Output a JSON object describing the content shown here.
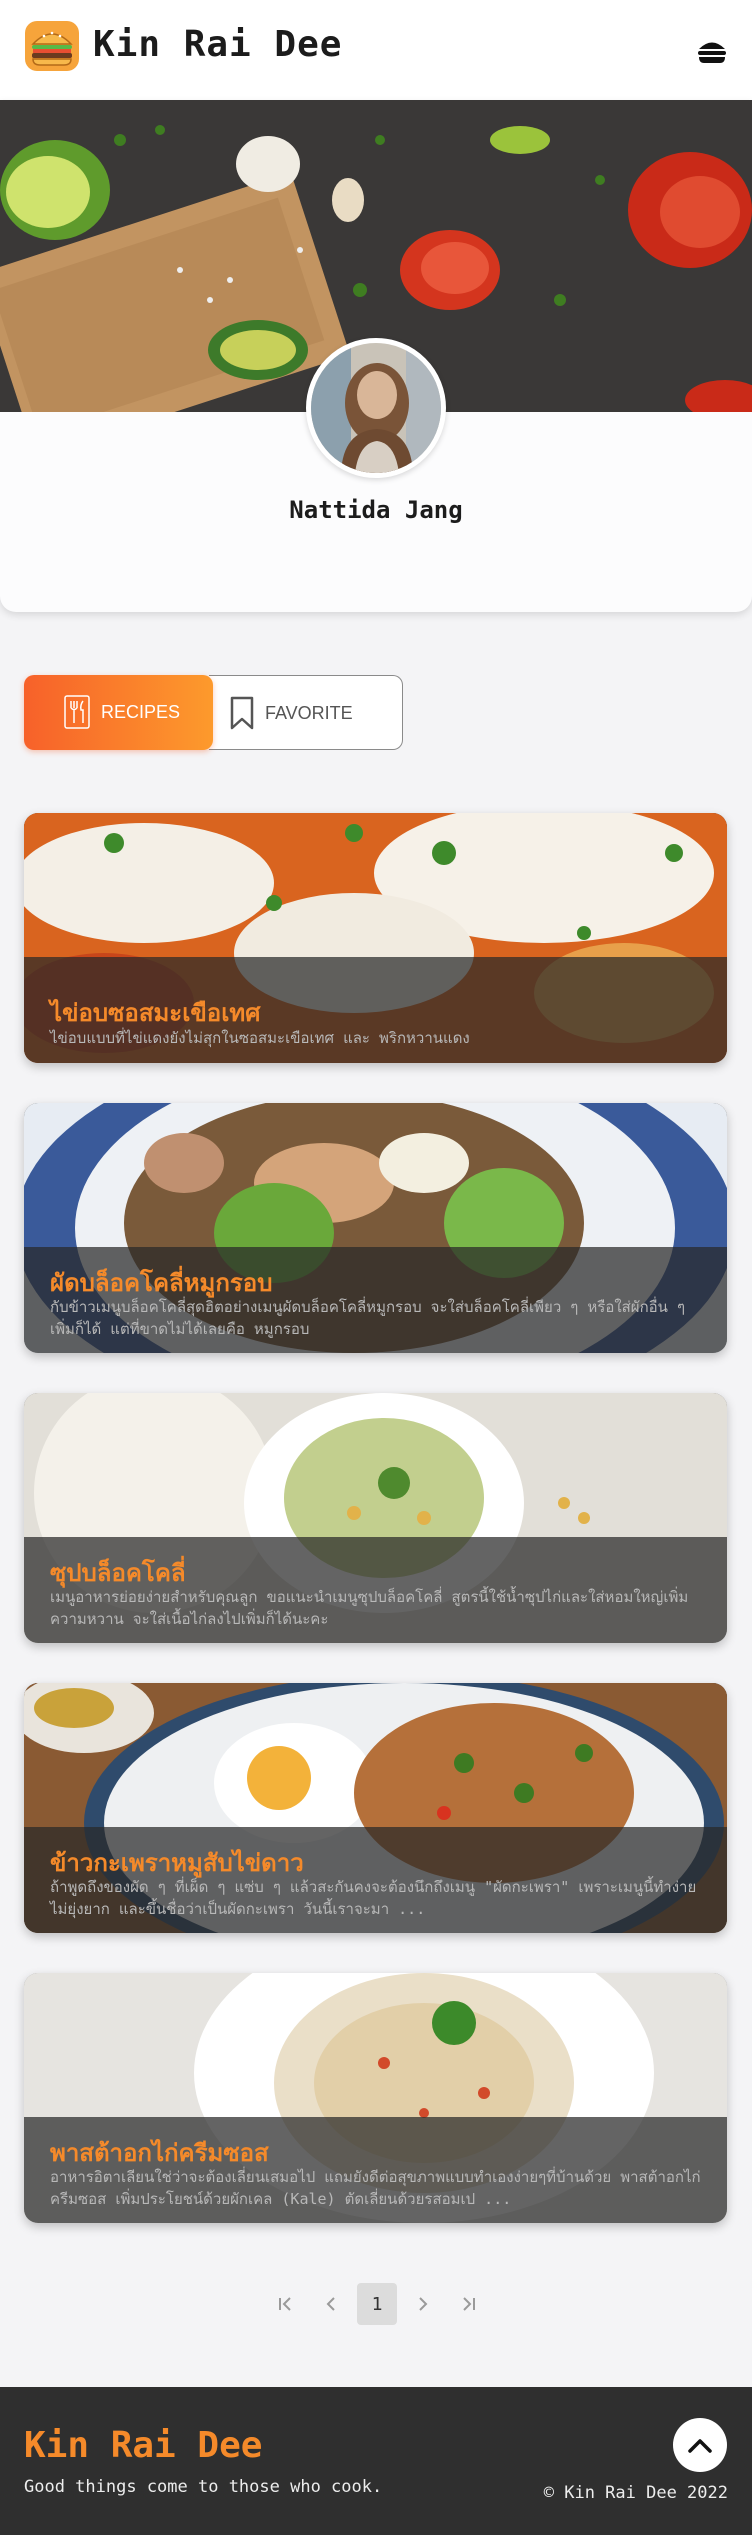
{
  "header": {
    "brand": "Kin Rai Dee",
    "logo_icon": "burger-icon",
    "menu_icon": "burger-menu-icon"
  },
  "profile": {
    "name": "Nattida Jang"
  },
  "tabs": [
    {
      "label": "RECIPES",
      "icon": "cutlery-icon",
      "active": true
    },
    {
      "label": "FAVORITE",
      "icon": "bookmark-icon",
      "active": false
    }
  ],
  "recipes": [
    {
      "title": "ไข่อบซอสมะเขือเทศ",
      "description": "ไข่อบแบบที่ไข่แดงยังไม่สุกในซอสมะเขือเทศ และ พริกหวานแดง"
    },
    {
      "title": "ผัดบล็อคโคลี่หมูกรอบ",
      "description": "กับข้าวเมนูบล็อคโคลี่สุดฮิตอย่างเมนูผัดบล็อคโคลี่หมูกรอบ จะใส่บล็อคโคลี่เพียว ๆ หรือใส่ผักอื่น ๆ เพิ่มก็ได้ แต่ที่ขาดไม่ได้เลยคือ หมูกรอบ"
    },
    {
      "title": "ซุปบล็อคโคลี่",
      "description": "เมนูอาหารย่อยง่ายสำหรับคุณลูก ขอแนะนำเมนูซุปบล็อคโคลี่ สูตรนี้ใช้น้ำซุปไก่และใส่หอมใหญ่เพิ่มความหวาน จะใส่เนื้อไก่ลงไปเพิ่มก็ได้นะคะ"
    },
    {
      "title": "ข้าวกะเพราหมูสับไข่ดาว",
      "description": "ถ้าพูดถึงของผัด ๆ ที่เผ็ด ๆ แซ่บ ๆ แล้วสะกันคงจะต้องนึกถึงเมนู \"ผัดกะเพรา\" เพราะเมนูนี้ทำง่ายไม่ยุ่งยาก และขึ้นชื่อว่าเป็นผัดกะเพรา วันนี้เราจะมา ..."
    },
    {
      "title": "พาสต้าอกไก่ครีมซอส",
      "description": "อาหารอิตาเลียนใช่ว่าจะต้องเลี่ยนเสมอไป แถมยังดีต่อสุขภาพแบบทำเองง่ายๆที่บ้านด้วย พาสต้าอกไก่ครีมซอส เพิ่มประโยชน์ด้วยผักเคล (Kale) ตัดเลี่ยนด้วยรสอมเป ..."
    }
  ],
  "pagination": {
    "first_icon": "first-page-icon",
    "prev_icon": "prev-page-icon",
    "current": "1",
    "next_icon": "next-page-icon",
    "last_icon": "last-page-icon"
  },
  "footer": {
    "brand": "Kin Rai Dee",
    "tagline": "Good things come to those who cook.",
    "copyright": "© Kin Rai Dee 2022",
    "back_to_top_icon": "chevron-up-icon"
  },
  "colors": {
    "accent": "#f58a2a",
    "tab_gradient_start": "#f7612a",
    "tab_gradient_end": "#fd9a2c",
    "footer_bg": "#2f2f2f"
  }
}
